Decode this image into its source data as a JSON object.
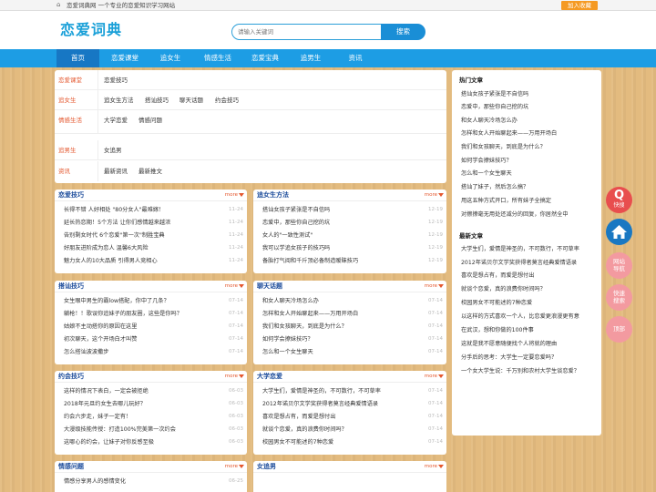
{
  "topbar": {
    "site_text": "恋爱词典网 一个专业的恋爱知识学习网站",
    "fav_label": "加入收藏"
  },
  "header": {
    "logo": "恋爱词典",
    "search_placeholder": "请输入关键词",
    "search_button": "搜索"
  },
  "nav": [
    "首页",
    "恋爱课堂",
    "追女生",
    "情感生活",
    "恋爱宝典",
    "追男生",
    "资讯"
  ],
  "categories": [
    {
      "label": "恋爱课堂",
      "links": [
        "恋爱技巧"
      ]
    },
    {
      "label": "追女生",
      "links": [
        "追女生方法",
        "搭讪技巧",
        "聊天话题",
        "约会技巧"
      ]
    },
    {
      "label": "情感生活",
      "links": [
        "大学恋爱",
        "情感问题"
      ]
    },
    {
      "label": "追男生",
      "links": [
        "女追男"
      ]
    },
    {
      "label": "资讯",
      "links": [
        "最新资讯",
        "最新推文"
      ]
    }
  ],
  "more_label": "more",
  "panels": [
    {
      "title": "恋爱技巧",
      "rows": [
        {
          "t": "长得不错 人好相处 \"80分女人\"最难嫁！",
          "d": "11-24"
        },
        {
          "t": "延长热恋期！5个方法 让你们感情越来越浓",
          "d": "11-24"
        },
        {
          "t": "告别剩女时代 6个恋爱\"第一次\"制胜宝典",
          "d": "11-24"
        },
        {
          "t": "好朋友进阶成为恋人 温馨6大风险",
          "d": "11-24"
        },
        {
          "t": "魅力女人的10大品质 引得男人竞相心",
          "d": "11-24"
        }
      ]
    },
    {
      "title": "追女生方法",
      "rows": [
        {
          "t": "搭讪女孩子紧张是不自信吗",
          "d": "12-19"
        },
        {
          "t": "恋爱中，那些你自己挖的坑",
          "d": "12-19"
        },
        {
          "t": "女人的\"一致性测试\"",
          "d": "12-19"
        },
        {
          "t": "我可以学追女孩子的技巧吗",
          "d": "12-19"
        },
        {
          "t": "备胎打气阅和千斤顶必备制造暧昧技巧",
          "d": "12-19"
        }
      ]
    },
    {
      "title": "搭讪技巧",
      "rows": [
        {
          "t": "女生眼中男生的霸low搭配，你中了几条？",
          "d": "07-14"
        },
        {
          "t": "躺枪！！歌误你追妹子的朋友圈，这些是你吗？",
          "d": "07-14"
        },
        {
          "t": "姑娘不主动搭你的原因在这里",
          "d": "07-14"
        },
        {
          "t": "初次聊天，这个开场白才叫赞",
          "d": "07-14"
        },
        {
          "t": "怎么搭讪波波撒步",
          "d": "07-14"
        }
      ]
    },
    {
      "title": "聊天话题",
      "rows": [
        {
          "t": "和女人聊天冷场怎么办",
          "d": "07-14"
        },
        {
          "t": "怎样和女人开始聊起来——万用开场白",
          "d": "07-14"
        },
        {
          "t": "我们和女孩聊天，到底是为什么？",
          "d": "07-14"
        },
        {
          "t": "如何学会撩妹技巧？",
          "d": "07-14"
        },
        {
          "t": "怎么和一个女生聊天",
          "d": "07-14"
        }
      ]
    },
    {
      "title": "约会技巧",
      "rows": [
        {
          "t": "这样的情况下表白，一定会被拒绝",
          "d": "06-03"
        },
        {
          "t": "2018年元旦约女生去哪儿玩好？",
          "d": "06-03"
        },
        {
          "t": "约会六步走，妹子一定有！",
          "d": "06-03"
        },
        {
          "t": "大漫级技能传授：打造100%完美第一次约会",
          "d": "06-03"
        },
        {
          "t": "这哪心的约会，让妹子对你反感至极",
          "d": "06-03"
        }
      ]
    },
    {
      "title": "大学恋爱",
      "rows": [
        {
          "t": "大学生们，爱情是神圣的，不可数行，不可草率",
          "d": "07-14"
        },
        {
          "t": "2012年诺贝尔文学奖获得者莫言经典爱情语录",
          "d": "07-14"
        },
        {
          "t": "喜欢是想占有，而爱是想付出",
          "d": "07-14"
        },
        {
          "t": "就谈个恋爱，真的浪费你时间吗？",
          "d": "07-14"
        },
        {
          "t": "校园男女不可能述的7种恋爱",
          "d": "07-14"
        }
      ]
    },
    {
      "title": "情感问题",
      "rows": [
        {
          "t": "情感分享男人的感情变化",
          "d": "06-25"
        }
      ]
    },
    {
      "title": "女追男",
      "rows": []
    }
  ],
  "sidebar": {
    "hot_title": "热门文章",
    "hot": [
      "搭讪女孩子紧张是不自信吗",
      "恋爱中，那些你自己挖的坑",
      "和女人聊天冷场怎么办",
      "怎样和女人开始聊起来——万用开场白",
      "我们和女孩聊天，到底是为什么？",
      "如何学会撩妹技巧？",
      "怎么和一个女生聊天",
      "搭讪了妹子，然后怎么搞？",
      "用这五种方式开口，所有妹子全搞定",
      "对擦撩毫无用处还减分的回复，你居然全中"
    ],
    "new_title": "最新文章",
    "new": [
      "大学生们，爱情是神圣的，不可数行，不可草率",
      "2012年诺贝尔文学奖获得者莫言经典爱情语录",
      "喜欢是想占有，而爱是想付出",
      "就谈个恋爱，真的浪费你时间吗？",
      "校园男女不可能述的7种恋爱",
      "以这样的方式喜欢一个人，比恋爱更浪漫更有意",
      "在武汉，想和你做的100件事",
      "这就是我不愿意随便找个人将就的理由",
      "分手后的思考：大学生一定要恋爱吗？",
      "一个女大学生说：千万别和农村大学生谈恋爱？"
    ]
  },
  "floats": [
    "快搜",
    "网站导航",
    "快速搜索",
    "顶部"
  ],
  "colors": {
    "brand": "#1d9de4",
    "nav_active": "#1777c4",
    "accent": "#e4572e",
    "fav": "#f59a23",
    "float_red": "#e84e4e",
    "float_blue": "#1a78c2",
    "float_pink": "#f39aa0"
  }
}
